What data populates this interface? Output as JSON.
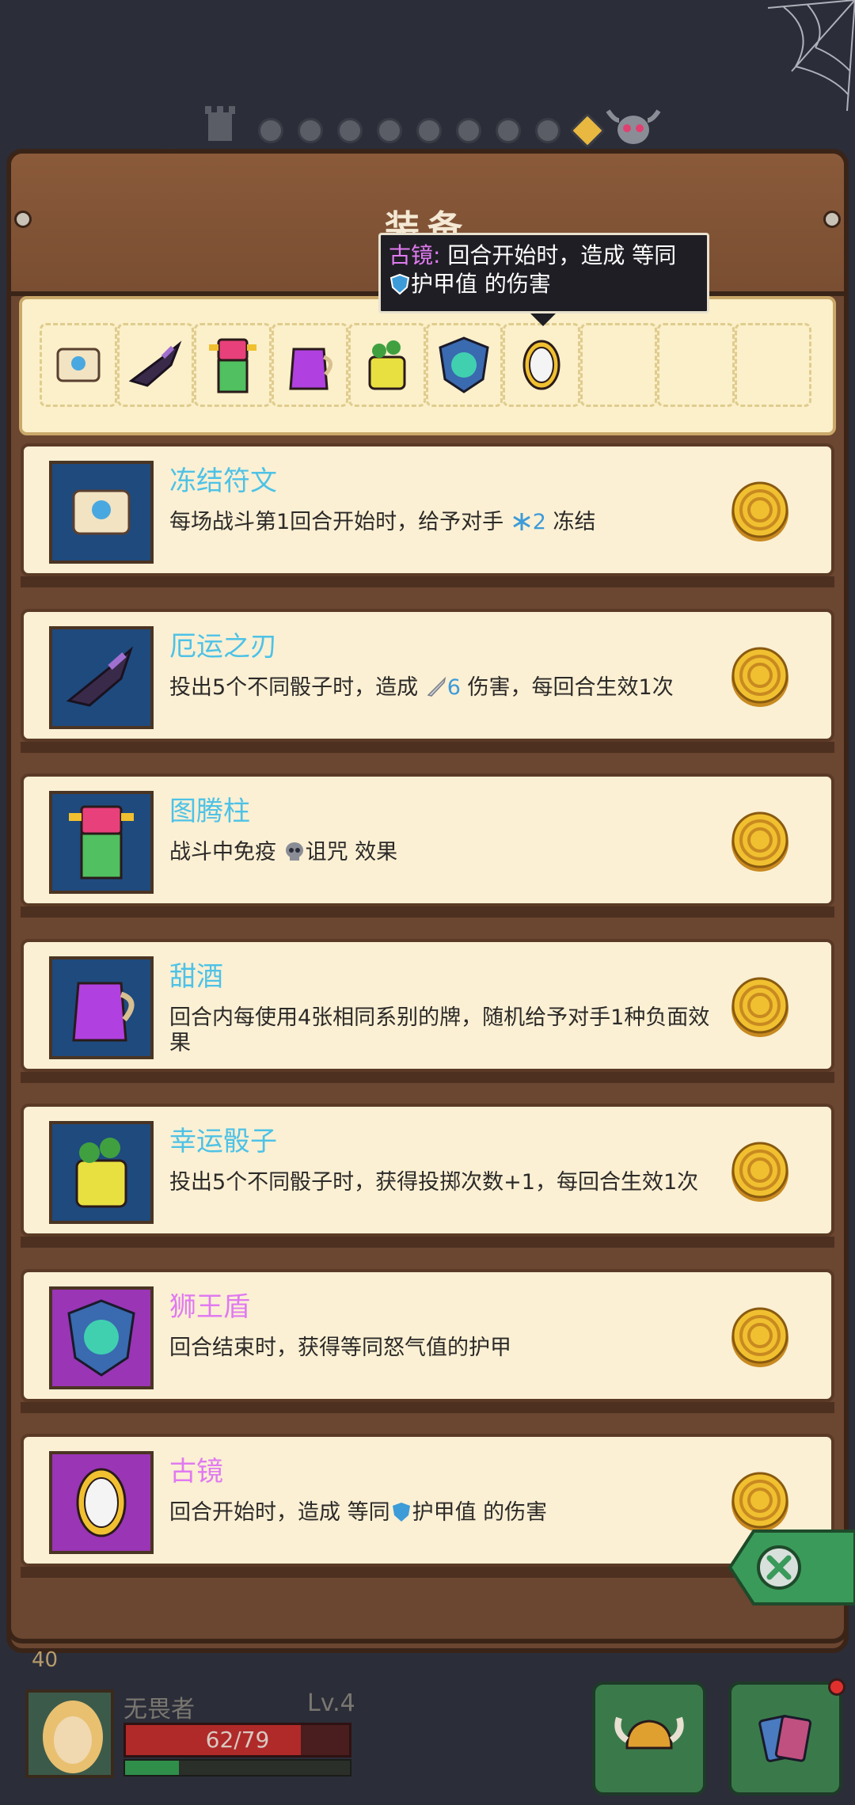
{
  "screen": {
    "title": "装备"
  },
  "tooltip": {
    "name": "古镜:",
    "line1": "回合开始时，造成 等同",
    "line2": "护甲值 的伤害",
    "shield_icon": "shield-icon"
  },
  "equipped_slots": [
    {
      "icon": "scroll-icon",
      "filled": true
    },
    {
      "icon": "dagger-icon",
      "filled": true
    },
    {
      "icon": "totem-icon",
      "filled": true
    },
    {
      "icon": "pitcher-icon",
      "filled": true
    },
    {
      "icon": "clover-dice-icon",
      "filled": true
    },
    {
      "icon": "lion-shield-icon",
      "filled": true
    },
    {
      "icon": "mirror-icon",
      "filled": true
    },
    {
      "icon": "",
      "filled": false
    },
    {
      "icon": "",
      "filled": false
    },
    {
      "icon": "",
      "filled": false
    }
  ],
  "items": [
    {
      "name": "冻结符文",
      "desc_pre": "每场战斗第1回合开始时，给予对手 ",
      "value": "2",
      "desc_post": " 冻结",
      "icon": "scroll-icon",
      "inline_icon": "snowflake-icon",
      "color": "blue"
    },
    {
      "name": "厄运之刃",
      "desc_pre": "投出5个不同骰子时，造成 ",
      "value": "6",
      "desc_post": " 伤害，每回合生效1次",
      "icon": "dagger-icon",
      "inline_icon": "sword-icon",
      "color": "blue"
    },
    {
      "name": "图腾柱",
      "desc_pre": "战斗中免疫 ",
      "value": "诅咒",
      "desc_post": " 效果",
      "icon": "totem-icon",
      "inline_icon": "skull-icon",
      "color": "blue"
    },
    {
      "name": "甜酒",
      "desc_pre": "回合内每使用4张相同系别的牌，随机给予对手1种负面效果",
      "value": "",
      "desc_post": "",
      "icon": "pitcher-icon",
      "inline_icon": "",
      "color": "blue"
    },
    {
      "name": "幸运骰子",
      "desc_pre": "投出5个不同骰子时，获得投掷次数+1，每回合生效1次",
      "value": "",
      "desc_post": "",
      "icon": "clover-dice-icon",
      "inline_icon": "",
      "color": "blue"
    },
    {
      "name": "狮王盾",
      "desc_pre": "回合结束时，获得等同怒气值的护甲",
      "value": "",
      "desc_post": "",
      "icon": "lion-shield-icon",
      "inline_icon": "",
      "color": "purple"
    },
    {
      "name": "古镜",
      "desc_pre": "回合开始时，造成 等同",
      "value": "护甲值",
      "desc_post": " 的伤害",
      "icon": "mirror-icon",
      "inline_icon": "shield-icon",
      "color": "purple"
    }
  ],
  "hud": {
    "coins": "40",
    "player_name": "无畏者",
    "level": "Lv.4",
    "hp_text": "62/79",
    "hp_fraction": 0.785,
    "xp_fraction": 0.24
  },
  "colors": {
    "board": "#6b4630",
    "card_bg": "#fbf0d4",
    "item_name_blue": "#4ec2e6",
    "item_name_pink": "#e07af0",
    "hp": "#b02a2a",
    "xp": "#2f8f4a",
    "close_button": "#3a9a5a"
  }
}
